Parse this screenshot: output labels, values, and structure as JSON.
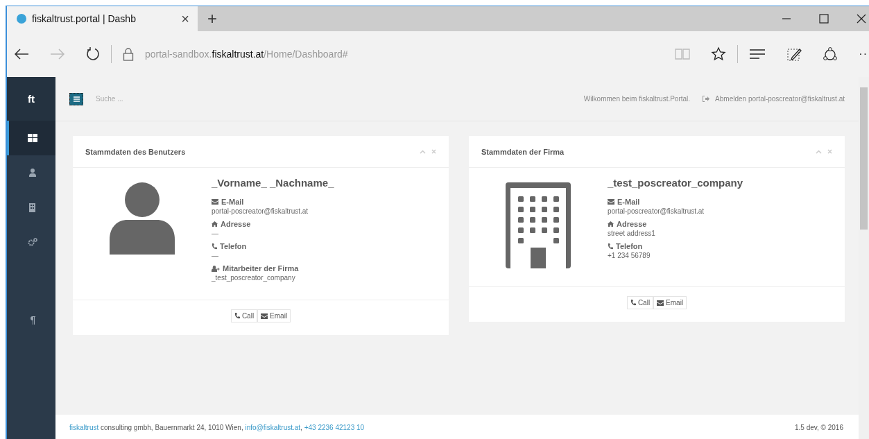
{
  "browser": {
    "tab": {
      "title": "fiskaltrust.portal | Dashb",
      "close": "×"
    },
    "new_tab": "+",
    "url": {
      "prefix": "portal-sandbox.",
      "domain": "fiskaltrust.at",
      "path": "/Home/Dashboard#"
    },
    "more": "··"
  },
  "sidebar": {
    "logo": "ft",
    "items": [
      {
        "kind": "dashboard",
        "selected": true
      },
      {
        "kind": "user",
        "selected": false
      },
      {
        "kind": "building",
        "selected": false
      },
      {
        "kind": "gears",
        "selected": false
      },
      {
        "kind": "paragraph",
        "selected": false
      }
    ]
  },
  "header": {
    "search": {
      "placeholder": "Suche ..."
    },
    "welcome": "Wilkommen beim fiskaltrust.Portal.",
    "logout": "Abmelden portal-poscreator@fiskaltrust.at"
  },
  "cards": [
    {
      "title": "Stammdaten des Benutzers",
      "kind": "user",
      "name": "_Vorname_ _Nachname_",
      "fields": [
        {
          "kind": "email",
          "label": "E-Mail",
          "value": "portal-poscreator@fiskaltrust.at"
        },
        {
          "kind": "home",
          "label": "Adresse",
          "value": "—"
        },
        {
          "kind": "phone",
          "label": "Telefon",
          "value": "—"
        },
        {
          "kind": "employees",
          "label": "Mitarbeiter der Firma",
          "value": "_test_poscreator_company"
        }
      ],
      "buttons": [
        {
          "kind": "phone",
          "label": "Call"
        },
        {
          "kind": "email",
          "label": "Email"
        }
      ]
    },
    {
      "title": "Stammdaten der Firma",
      "kind": "building",
      "name": "_test_poscreator_company",
      "fields": [
        {
          "kind": "email",
          "label": "E-Mail",
          "value": "portal-poscreator@fiskaltrust.at"
        },
        {
          "kind": "home",
          "label": "Adresse",
          "value": "street address1"
        },
        {
          "kind": "phone",
          "label": "Telefon",
          "value": "+1 234 56789"
        }
      ],
      "buttons": [
        {
          "kind": "phone",
          "label": "Call"
        },
        {
          "kind": "email",
          "label": "Email"
        }
      ]
    }
  ],
  "footer": {
    "parts": [
      {
        "kind": "link",
        "text": "fiskaltrust"
      },
      {
        "kind": "text",
        "text": " consulting gmbh, Bauernmarkt 24, 1010 Wien, "
      },
      {
        "kind": "link",
        "text": "info@fiskaltrust.at"
      },
      {
        "kind": "text",
        "text": ", "
      },
      {
        "kind": "link",
        "text": "+43 2236 42123 10"
      }
    ],
    "version": "1.5 dev, © 2016"
  }
}
